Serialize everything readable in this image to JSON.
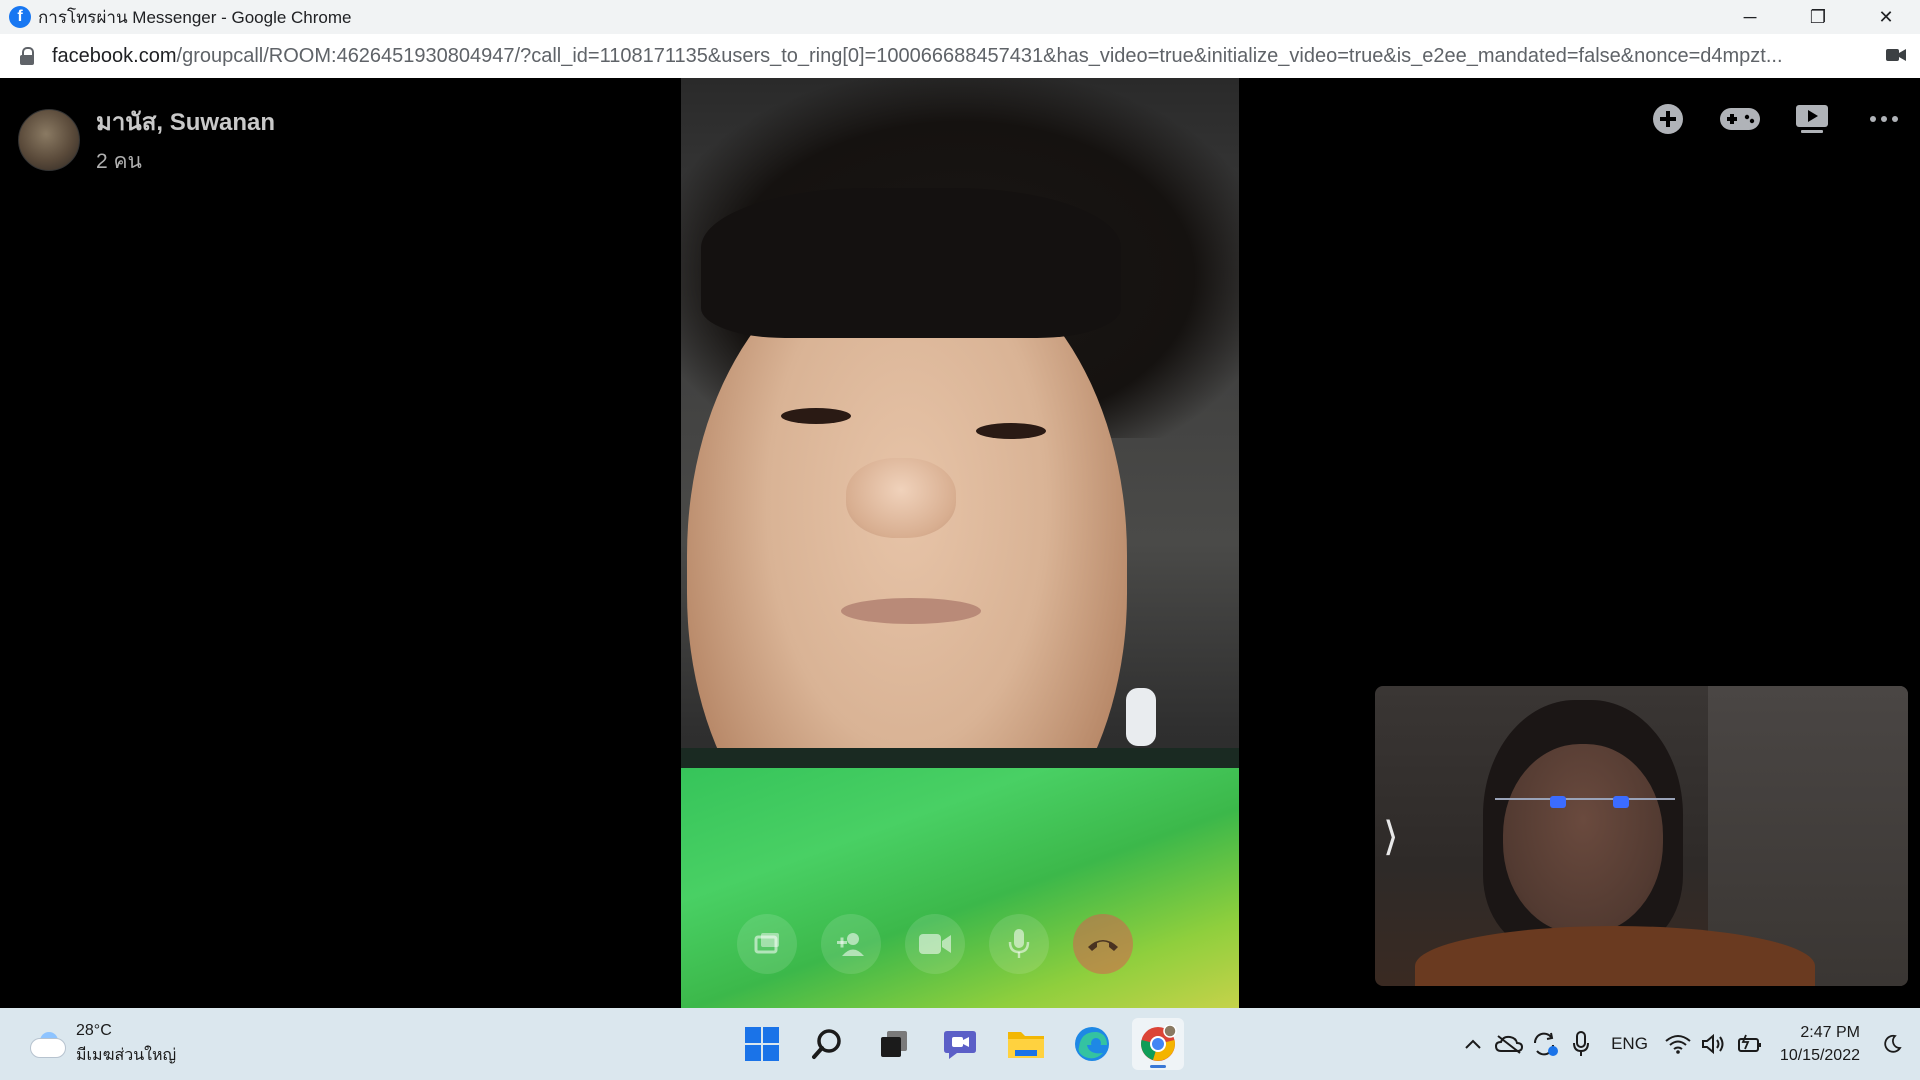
{
  "browser": {
    "window_title": "การโทรผ่าน Messenger - Google Chrome",
    "url_host": "facebook.com",
    "url_path": "/groupcall/ROOM:4626451930804947/?call_id=1108171135&users_to_ring[0]=100066688457431&has_video=true&initialize_video=true&is_e2ee_mandated=false&nonce=d4mpzt...",
    "favicon_letter": "f",
    "window_controls": {
      "minimize": "─",
      "restore": "❐",
      "close": "✕"
    }
  },
  "call": {
    "title": "มานัส, Suwanan",
    "participants_text": "2 คน",
    "top_actions": [
      "add-icon",
      "game-controller-icon",
      "watch-together-icon",
      "more-icon"
    ],
    "controls": [
      "share-screen-icon",
      "add-person-icon",
      "camera-icon",
      "microphone-icon",
      "end-call-icon"
    ],
    "collapse_arrow": "⟩"
  },
  "taskbar": {
    "weather_temp": "28°C",
    "weather_desc": "มีเมฆส่วนใหญ่",
    "apps": [
      "windows-start-icon",
      "search-icon",
      "task-view-icon",
      "teams-chat-icon",
      "file-explorer-icon",
      "edge-icon",
      "chrome-icon"
    ],
    "language": "ENG",
    "time": "2:47 PM",
    "date": "10/15/2022"
  },
  "colors": {
    "facebook_blue": "#1877f2",
    "taskbar_bg": "#dbe7ee",
    "end_call": "#d6604f"
  }
}
